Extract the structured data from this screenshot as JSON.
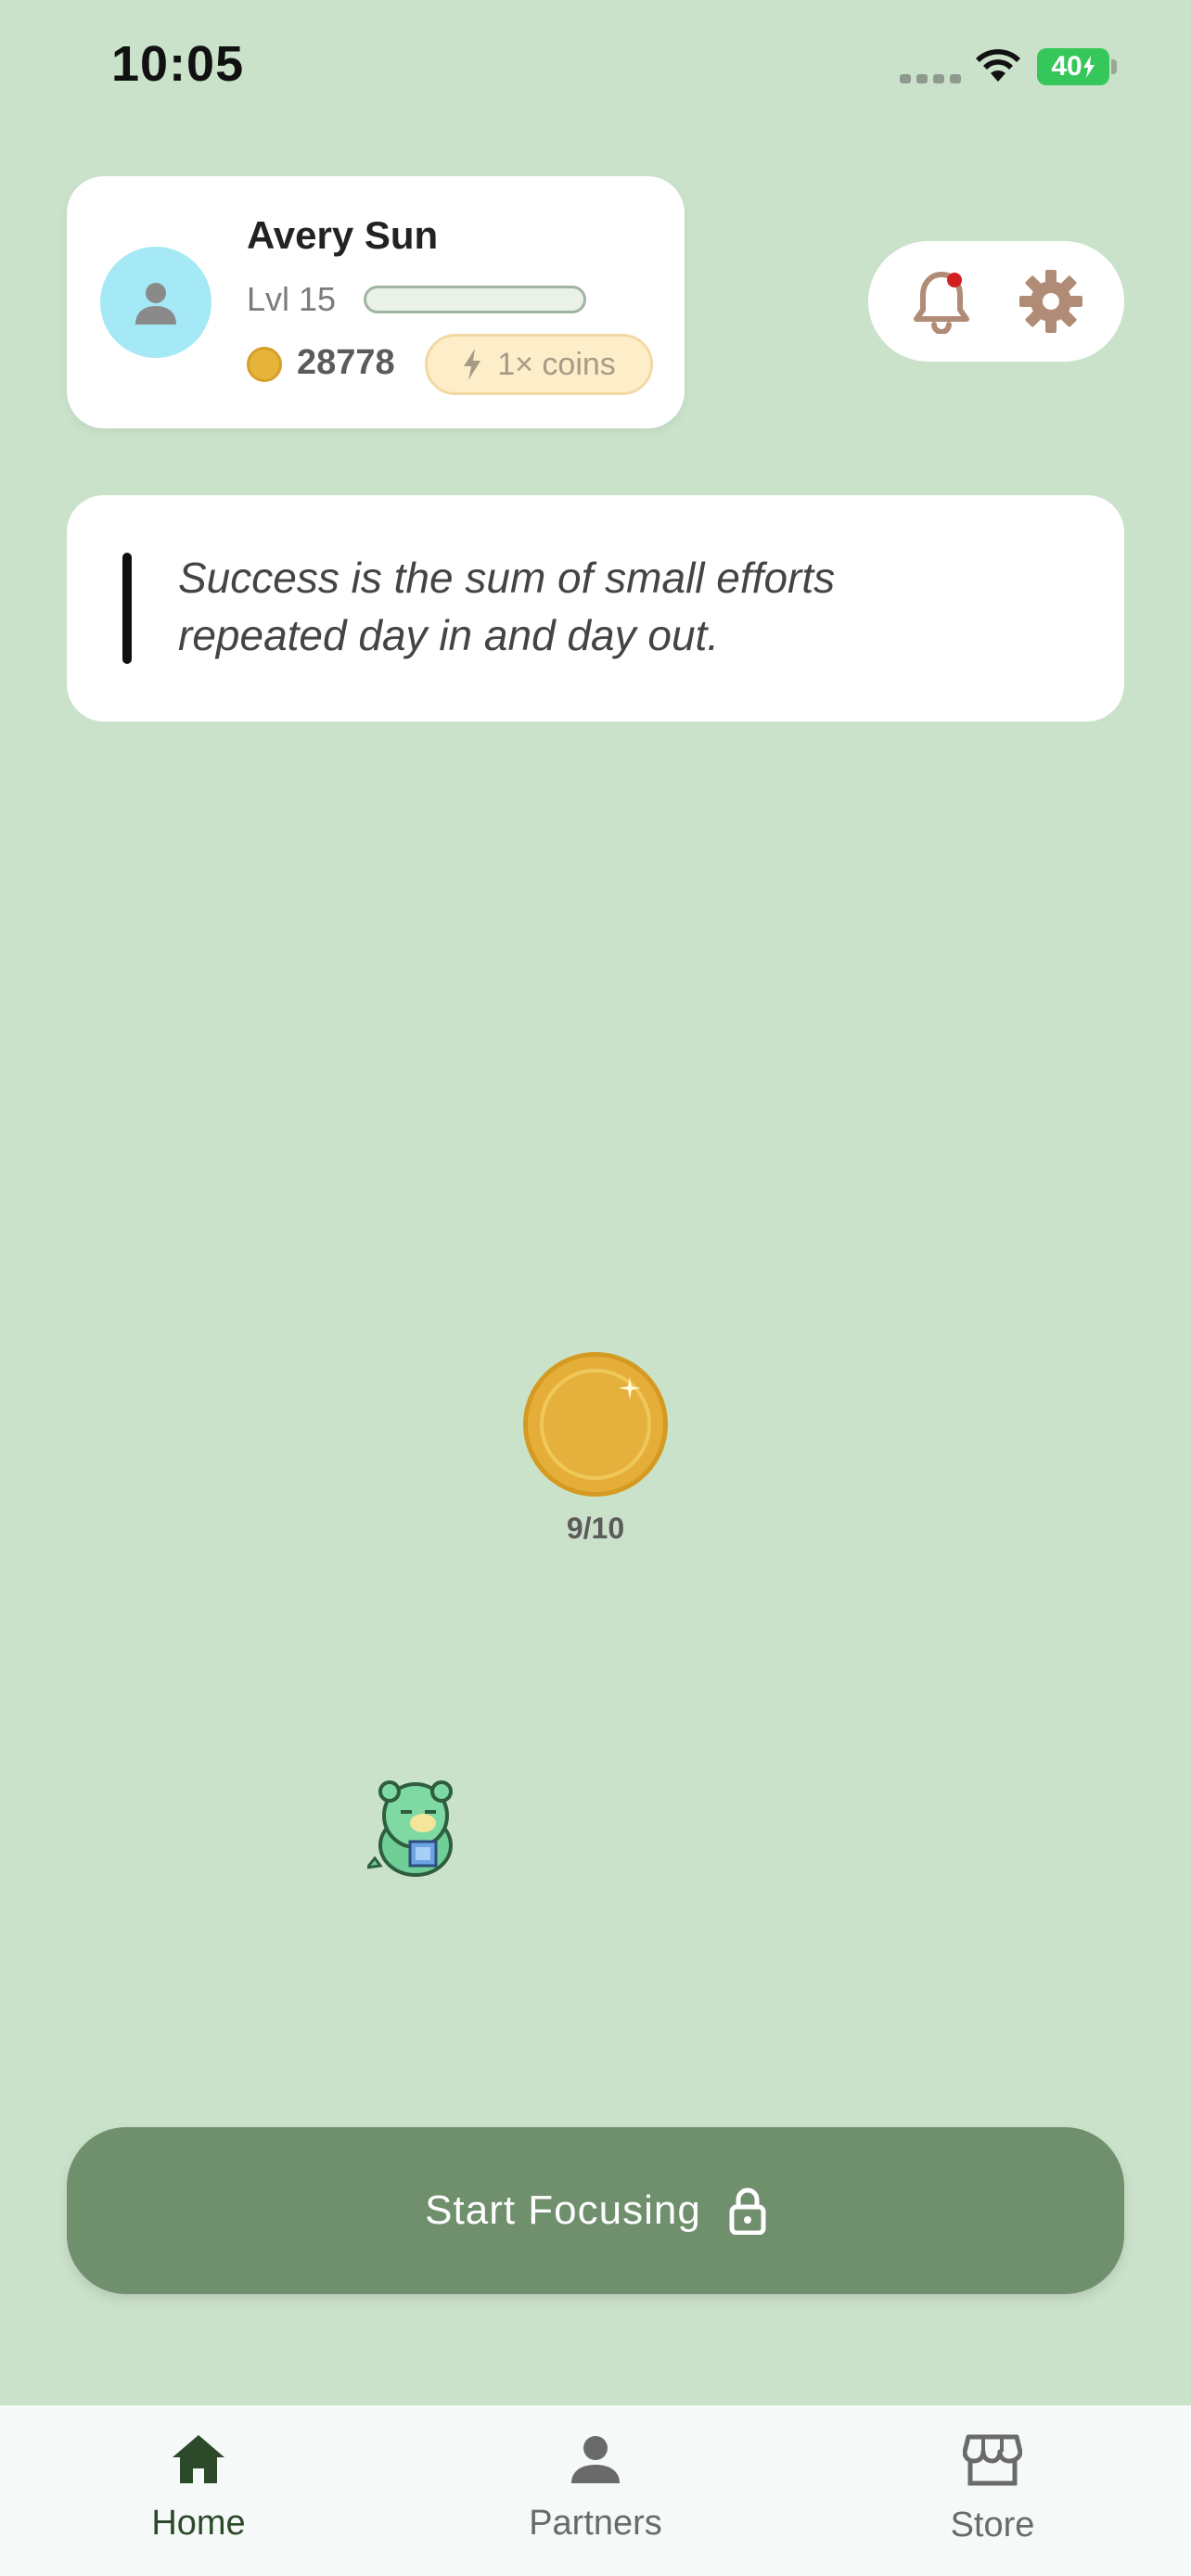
{
  "status_bar": {
    "time": "10:05",
    "battery": "40"
  },
  "profile": {
    "name": "Avery Sun",
    "level": "Lvl 15",
    "xp_progress": 0.0,
    "coins": "28778",
    "multiplier": "1× coins"
  },
  "quote": {
    "line1": "Success is the sum of small efforts",
    "line2": "repeated day in and day out."
  },
  "coin_goal": {
    "progress_text": "9/10"
  },
  "start_button": {
    "label": "Start Focusing"
  },
  "nav": {
    "items": [
      {
        "label": "Home",
        "icon": "home-icon",
        "active": true
      },
      {
        "label": "Partners",
        "icon": "person-icon",
        "active": false
      },
      {
        "label": "Store",
        "icon": "store-icon",
        "active": false
      }
    ]
  },
  "colors": {
    "background": "#cbe2ca",
    "primary_button": "#6f8f6d",
    "coin": "#e5ae38",
    "icon_brown": "#b08c76",
    "nav_active": "#2c4a2a",
    "nav_inactive": "#6a6a6a"
  }
}
